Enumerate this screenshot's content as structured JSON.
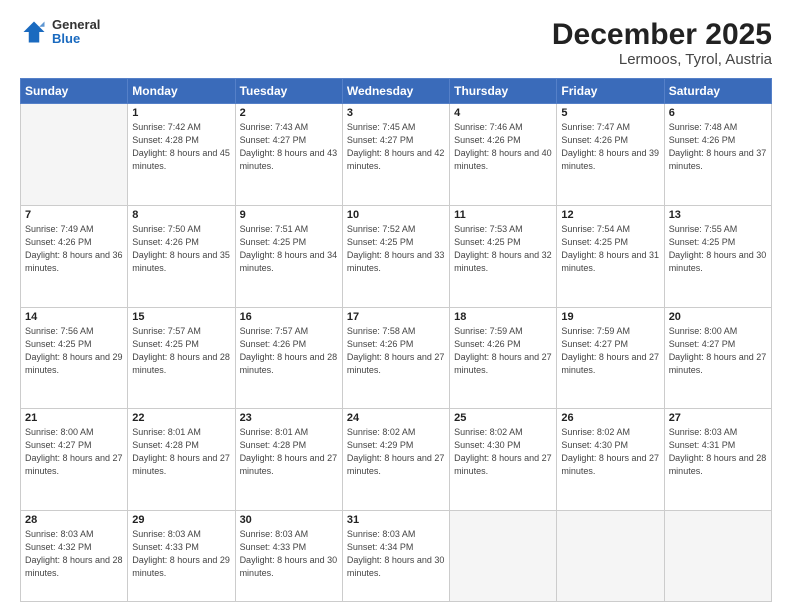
{
  "header": {
    "logo_general": "General",
    "logo_blue": "Blue",
    "month": "December 2025",
    "location": "Lermoos, Tyrol, Austria"
  },
  "weekdays": [
    "Sunday",
    "Monday",
    "Tuesday",
    "Wednesday",
    "Thursday",
    "Friday",
    "Saturday"
  ],
  "weeks": [
    [
      {
        "day": "",
        "sunrise": "",
        "sunset": "",
        "daylight": "",
        "empty": true
      },
      {
        "day": "1",
        "sunrise": "Sunrise: 7:42 AM",
        "sunset": "Sunset: 4:28 PM",
        "daylight": "Daylight: 8 hours and 45 minutes."
      },
      {
        "day": "2",
        "sunrise": "Sunrise: 7:43 AM",
        "sunset": "Sunset: 4:27 PM",
        "daylight": "Daylight: 8 hours and 43 minutes."
      },
      {
        "day": "3",
        "sunrise": "Sunrise: 7:45 AM",
        "sunset": "Sunset: 4:27 PM",
        "daylight": "Daylight: 8 hours and 42 minutes."
      },
      {
        "day": "4",
        "sunrise": "Sunrise: 7:46 AM",
        "sunset": "Sunset: 4:26 PM",
        "daylight": "Daylight: 8 hours and 40 minutes."
      },
      {
        "day": "5",
        "sunrise": "Sunrise: 7:47 AM",
        "sunset": "Sunset: 4:26 PM",
        "daylight": "Daylight: 8 hours and 39 minutes."
      },
      {
        "day": "6",
        "sunrise": "Sunrise: 7:48 AM",
        "sunset": "Sunset: 4:26 PM",
        "daylight": "Daylight: 8 hours and 37 minutes."
      }
    ],
    [
      {
        "day": "7",
        "sunrise": "Sunrise: 7:49 AM",
        "sunset": "Sunset: 4:26 PM",
        "daylight": "Daylight: 8 hours and 36 minutes."
      },
      {
        "day": "8",
        "sunrise": "Sunrise: 7:50 AM",
        "sunset": "Sunset: 4:26 PM",
        "daylight": "Daylight: 8 hours and 35 minutes."
      },
      {
        "day": "9",
        "sunrise": "Sunrise: 7:51 AM",
        "sunset": "Sunset: 4:25 PM",
        "daylight": "Daylight: 8 hours and 34 minutes."
      },
      {
        "day": "10",
        "sunrise": "Sunrise: 7:52 AM",
        "sunset": "Sunset: 4:25 PM",
        "daylight": "Daylight: 8 hours and 33 minutes."
      },
      {
        "day": "11",
        "sunrise": "Sunrise: 7:53 AM",
        "sunset": "Sunset: 4:25 PM",
        "daylight": "Daylight: 8 hours and 32 minutes."
      },
      {
        "day": "12",
        "sunrise": "Sunrise: 7:54 AM",
        "sunset": "Sunset: 4:25 PM",
        "daylight": "Daylight: 8 hours and 31 minutes."
      },
      {
        "day": "13",
        "sunrise": "Sunrise: 7:55 AM",
        "sunset": "Sunset: 4:25 PM",
        "daylight": "Daylight: 8 hours and 30 minutes."
      }
    ],
    [
      {
        "day": "14",
        "sunrise": "Sunrise: 7:56 AM",
        "sunset": "Sunset: 4:25 PM",
        "daylight": "Daylight: 8 hours and 29 minutes."
      },
      {
        "day": "15",
        "sunrise": "Sunrise: 7:57 AM",
        "sunset": "Sunset: 4:25 PM",
        "daylight": "Daylight: 8 hours and 28 minutes."
      },
      {
        "day": "16",
        "sunrise": "Sunrise: 7:57 AM",
        "sunset": "Sunset: 4:26 PM",
        "daylight": "Daylight: 8 hours and 28 minutes."
      },
      {
        "day": "17",
        "sunrise": "Sunrise: 7:58 AM",
        "sunset": "Sunset: 4:26 PM",
        "daylight": "Daylight: 8 hours and 27 minutes."
      },
      {
        "day": "18",
        "sunrise": "Sunrise: 7:59 AM",
        "sunset": "Sunset: 4:26 PM",
        "daylight": "Daylight: 8 hours and 27 minutes."
      },
      {
        "day": "19",
        "sunrise": "Sunrise: 7:59 AM",
        "sunset": "Sunset: 4:27 PM",
        "daylight": "Daylight: 8 hours and 27 minutes."
      },
      {
        "day": "20",
        "sunrise": "Sunrise: 8:00 AM",
        "sunset": "Sunset: 4:27 PM",
        "daylight": "Daylight: 8 hours and 27 minutes."
      }
    ],
    [
      {
        "day": "21",
        "sunrise": "Sunrise: 8:00 AM",
        "sunset": "Sunset: 4:27 PM",
        "daylight": "Daylight: 8 hours and 27 minutes."
      },
      {
        "day": "22",
        "sunrise": "Sunrise: 8:01 AM",
        "sunset": "Sunset: 4:28 PM",
        "daylight": "Daylight: 8 hours and 27 minutes."
      },
      {
        "day": "23",
        "sunrise": "Sunrise: 8:01 AM",
        "sunset": "Sunset: 4:28 PM",
        "daylight": "Daylight: 8 hours and 27 minutes."
      },
      {
        "day": "24",
        "sunrise": "Sunrise: 8:02 AM",
        "sunset": "Sunset: 4:29 PM",
        "daylight": "Daylight: 8 hours and 27 minutes."
      },
      {
        "day": "25",
        "sunrise": "Sunrise: 8:02 AM",
        "sunset": "Sunset: 4:30 PM",
        "daylight": "Daylight: 8 hours and 27 minutes."
      },
      {
        "day": "26",
        "sunrise": "Sunrise: 8:02 AM",
        "sunset": "Sunset: 4:30 PM",
        "daylight": "Daylight: 8 hours and 27 minutes."
      },
      {
        "day": "27",
        "sunrise": "Sunrise: 8:03 AM",
        "sunset": "Sunset: 4:31 PM",
        "daylight": "Daylight: 8 hours and 28 minutes."
      }
    ],
    [
      {
        "day": "28",
        "sunrise": "Sunrise: 8:03 AM",
        "sunset": "Sunset: 4:32 PM",
        "daylight": "Daylight: 8 hours and 28 minutes."
      },
      {
        "day": "29",
        "sunrise": "Sunrise: 8:03 AM",
        "sunset": "Sunset: 4:33 PM",
        "daylight": "Daylight: 8 hours and 29 minutes."
      },
      {
        "day": "30",
        "sunrise": "Sunrise: 8:03 AM",
        "sunset": "Sunset: 4:33 PM",
        "daylight": "Daylight: 8 hours and 30 minutes."
      },
      {
        "day": "31",
        "sunrise": "Sunrise: 8:03 AM",
        "sunset": "Sunset: 4:34 PM",
        "daylight": "Daylight: 8 hours and 30 minutes."
      },
      {
        "day": "",
        "sunrise": "",
        "sunset": "",
        "daylight": "",
        "empty": true
      },
      {
        "day": "",
        "sunrise": "",
        "sunset": "",
        "daylight": "",
        "empty": true
      },
      {
        "day": "",
        "sunrise": "",
        "sunset": "",
        "daylight": "",
        "empty": true
      }
    ]
  ]
}
